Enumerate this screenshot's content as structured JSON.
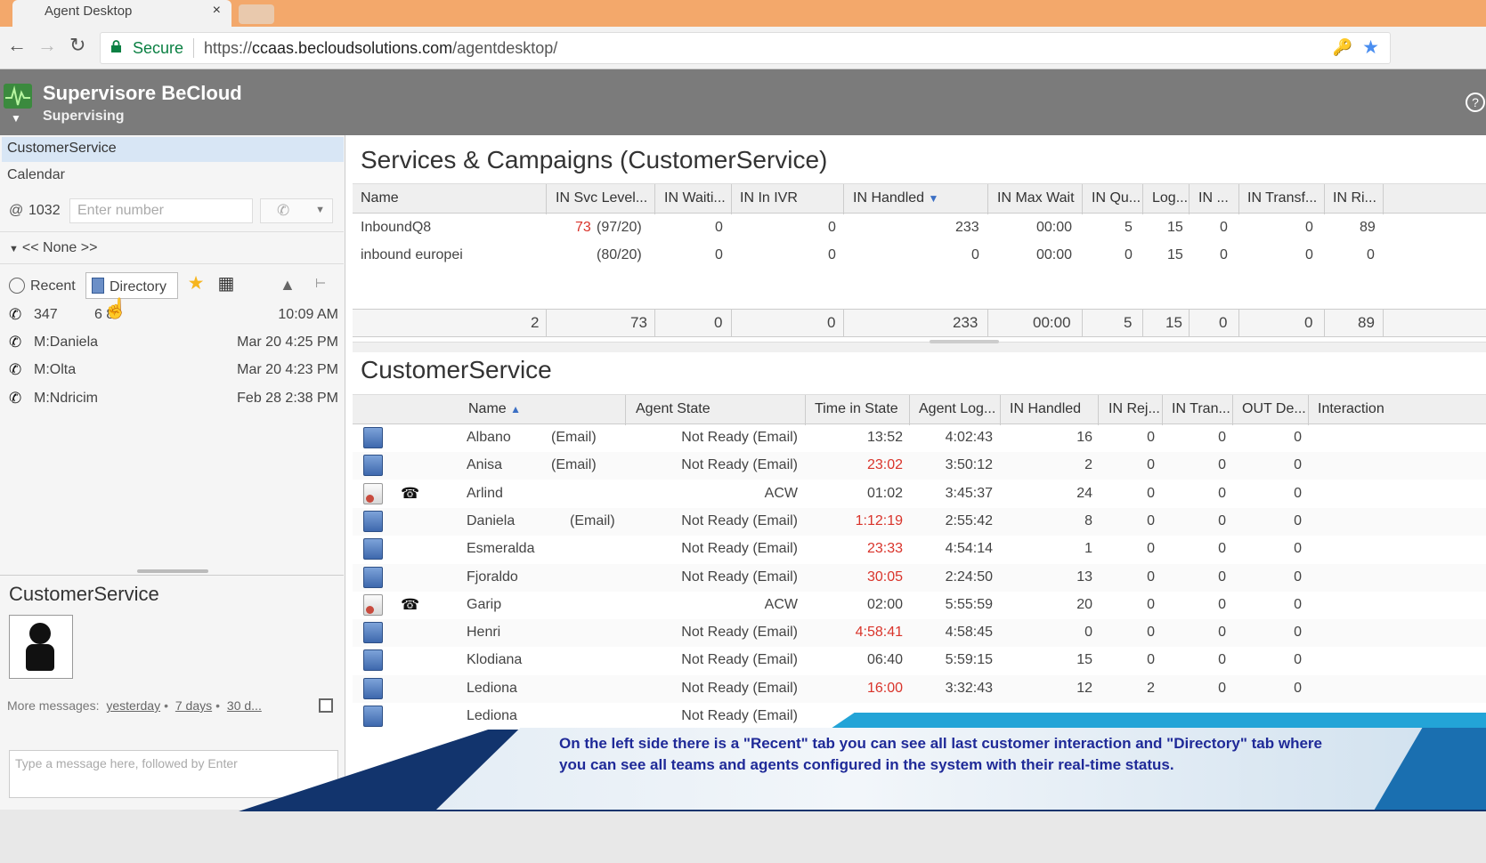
{
  "browser": {
    "tab_title": "Agent Desktop",
    "tab_close": "×",
    "secure_label": "Secure",
    "url_scheme": "https://",
    "url_host": "ccaas.becloudsolutions.com",
    "url_path": "/agentdesktop/"
  },
  "header": {
    "title": "Supervisore BeCloud",
    "subtitle": "Supervising",
    "help": "?"
  },
  "left": {
    "selected_item": "CustomerService",
    "calendar": "Calendar",
    "at_symbol": "@",
    "extension": "1032",
    "number_placeholder": "Enter number",
    "none_label": "<< None >>",
    "tabs": {
      "recent": "Recent",
      "directory": "Directory"
    },
    "recent_items": [
      {
        "name": "347",
        "extra": "6 8",
        "time": "10:09 AM"
      },
      {
        "name": "M:Daniela",
        "extra": "",
        "time": "Mar 20 4:25 PM"
      },
      {
        "name": "M:Olta",
        "extra": "",
        "time": "Mar 20 4:23 PM"
      },
      {
        "name": "M:Ndricim",
        "extra": "",
        "time": "Feb 28 2:38 PM"
      }
    ],
    "queue_title": "CustomerService",
    "more_messages": "More messages:",
    "more_links": [
      "yesterday",
      "7 days",
      "30 d..."
    ],
    "message_placeholder": "Type a message here, followed by Enter"
  },
  "services": {
    "title": "Services & Campaigns (CustomerService)",
    "columns": [
      "Name",
      "IN Svc Level...",
      "IN Waiti...",
      "IN In IVR",
      "IN Handled",
      "IN Max Wait",
      "IN Qu...",
      "Log...",
      "IN ...",
      "IN Transf...",
      "IN Ri..."
    ],
    "rows": [
      {
        "name": "InboundQ8",
        "svc_red": "73",
        "svc": "(97/20)",
        "waiting": "0",
        "ivr": "0",
        "handled": "233",
        "max_wait": "00:00",
        "queue": "5",
        "logged": "15",
        "in_x": "0",
        "transf": "0",
        "ring": "89"
      },
      {
        "name": "inbound europei",
        "svc_red": "",
        "svc": "(80/20)",
        "waiting": "0",
        "ivr": "0",
        "handled": "0",
        "max_wait": "00:00",
        "queue": "0",
        "logged": "15",
        "in_x": "0",
        "transf": "0",
        "ring": "0"
      }
    ],
    "totals": {
      "count": "2",
      "svc": "73",
      "waiting": "0",
      "ivr": "0",
      "handled": "233",
      "max_wait": "00:00",
      "queue": "5",
      "logged": "15",
      "in_x": "0",
      "transf": "0",
      "ring": "89"
    }
  },
  "agents": {
    "title": "CustomerService",
    "columns": [
      "Name",
      "Agent State",
      "Time in State",
      "Agent Log...",
      "IN Handled",
      "IN Rej...",
      "IN Tran...",
      "OUT De...",
      "Interaction"
    ],
    "rows": [
      {
        "name": "Albano",
        "channel": "(Email)",
        "state": "Not Ready (Email)",
        "time": "13:52",
        "time_red": false,
        "login": "4:02:43",
        "handled": "16",
        "rej": "0",
        "tran": "0",
        "out": "0",
        "icon": "agent",
        "phone": false
      },
      {
        "name": "Anisa",
        "channel": "(Email)",
        "state": "Not Ready (Email)",
        "time": "23:02",
        "time_red": true,
        "login": "3:50:12",
        "handled": "2",
        "rej": "0",
        "tran": "0",
        "out": "0",
        "icon": "agent",
        "phone": false
      },
      {
        "name": "Arlind",
        "channel": "",
        "state": "ACW",
        "time": "01:02",
        "time_red": false,
        "login": "3:45:37",
        "handled": "24",
        "rej": "0",
        "tran": "0",
        "out": "0",
        "icon": "acw",
        "phone": true
      },
      {
        "name": "Daniela",
        "channel": "(Email)",
        "state": "Not Ready (Email)",
        "time": "1:12:19",
        "time_red": true,
        "login": "2:55:42",
        "handled": "8",
        "rej": "0",
        "tran": "0",
        "out": "0",
        "icon": "agent",
        "phone": false
      },
      {
        "name": "Esmeralda",
        "channel": "",
        "state": "Not Ready (Email)",
        "time": "23:33",
        "time_red": true,
        "login": "4:54:14",
        "handled": "1",
        "rej": "0",
        "tran": "0",
        "out": "0",
        "icon": "agent",
        "phone": false
      },
      {
        "name": "Fjoraldo",
        "channel": "",
        "state": "Not Ready (Email)",
        "time": "30:05",
        "time_red": true,
        "login": "2:24:50",
        "handled": "13",
        "rej": "0",
        "tran": "0",
        "out": "0",
        "icon": "agent",
        "phone": false
      },
      {
        "name": "Garip",
        "channel": "",
        "state": "ACW",
        "time": "02:00",
        "time_red": false,
        "login": "5:55:59",
        "handled": "20",
        "rej": "0",
        "tran": "0",
        "out": "0",
        "icon": "acw",
        "phone": true
      },
      {
        "name": "Henri",
        "channel": "",
        "state": "Not Ready (Email)",
        "time": "4:58:41",
        "time_red": true,
        "login": "4:58:45",
        "handled": "0",
        "rej": "0",
        "tran": "0",
        "out": "0",
        "icon": "agent",
        "phone": false
      },
      {
        "name": "Klodiana",
        "channel": "",
        "state": "Not Ready (Email)",
        "time": "06:40",
        "time_red": false,
        "login": "5:59:15",
        "handled": "15",
        "rej": "0",
        "tran": "0",
        "out": "0",
        "icon": "agent",
        "phone": false
      },
      {
        "name": "Lediona",
        "channel": "",
        "state": "Not Ready (Email)",
        "time": "16:00",
        "time_red": true,
        "login": "3:32:43",
        "handled": "12",
        "rej": "2",
        "tran": "0",
        "out": "0",
        "icon": "agent",
        "phone": false
      },
      {
        "name": "Lediona",
        "channel": "",
        "state": "Not Ready (Email)",
        "time": "",
        "time_red": false,
        "login": "",
        "handled": "",
        "rej": "",
        "tran": "",
        "out": "",
        "icon": "agent",
        "phone": false
      }
    ]
  },
  "caption": "On the left side there is a \"Recent\" tab you can see all last customer interaction and \"Directory\" tab where you can see all teams and agents configured in the system with their real-time status.",
  "colors": {
    "accent": "#d8e6f5",
    "header": "#7b7b7b",
    "alert": "#d9342b",
    "tab_strip": "#f3a86b"
  }
}
